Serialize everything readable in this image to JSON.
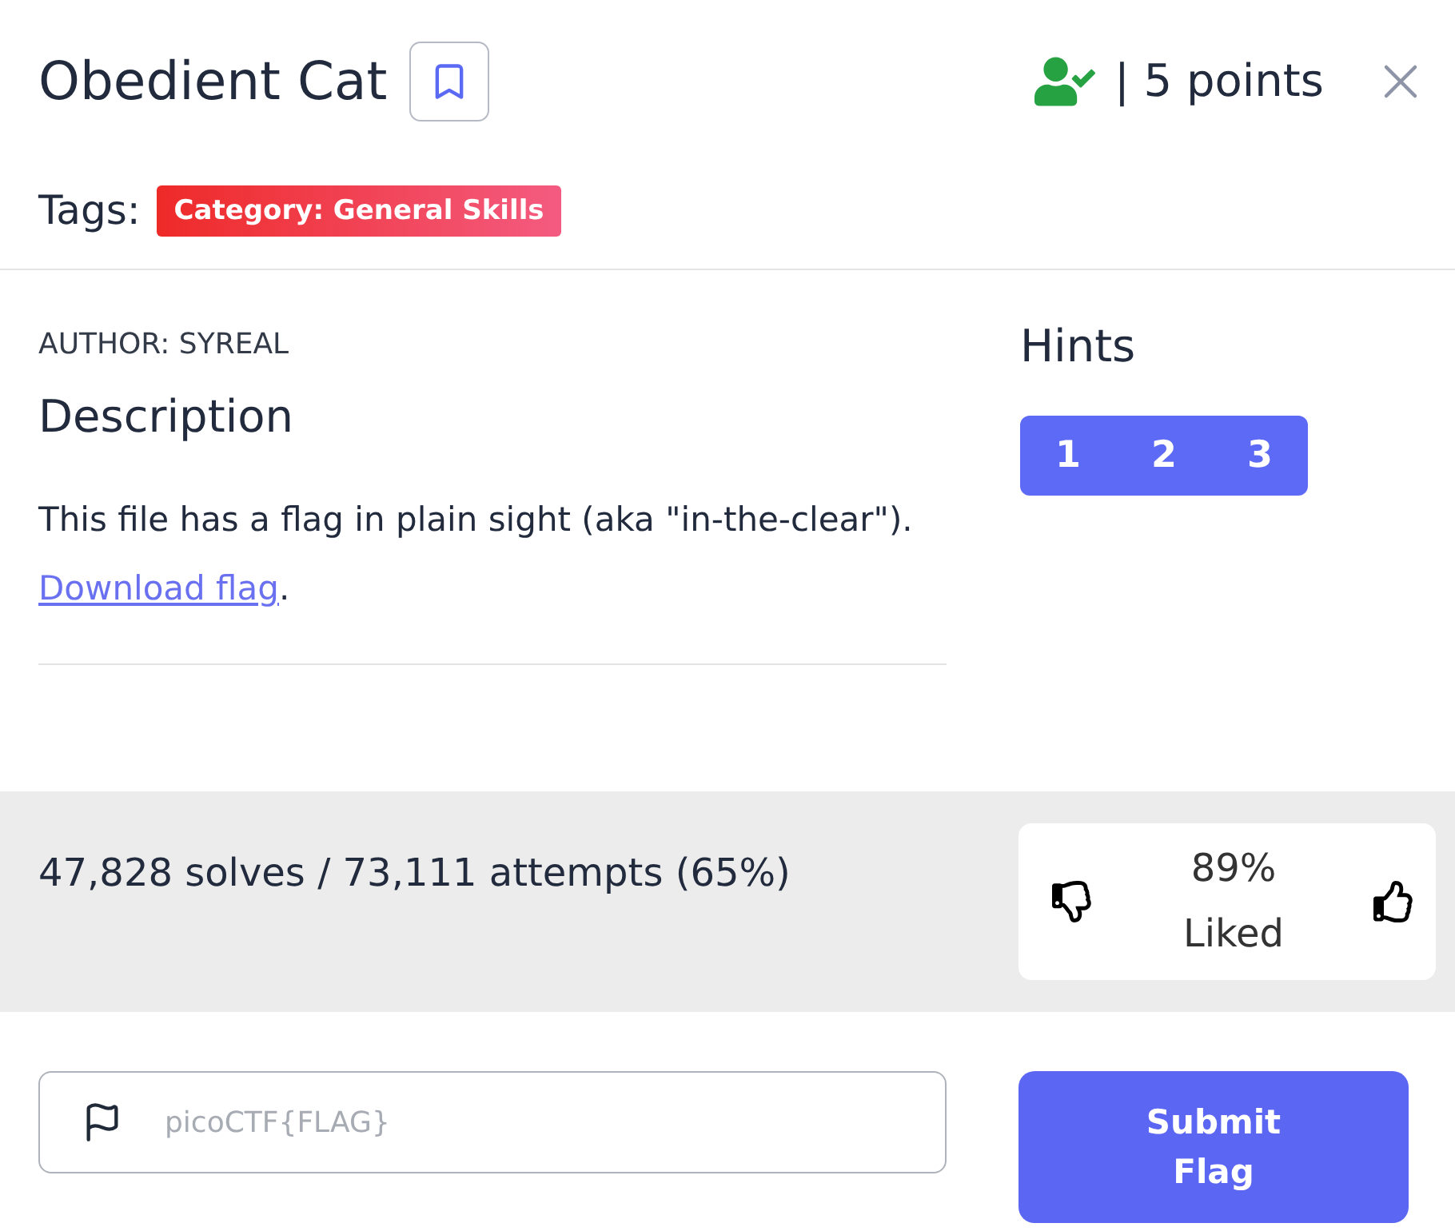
{
  "header": {
    "title": "Obedient Cat",
    "bookmarked": false,
    "solved": true,
    "points": "| 5 points"
  },
  "tags": {
    "label": "Tags:",
    "items": [
      {
        "text": "Category: General Skills"
      }
    ]
  },
  "description": {
    "author": "AUTHOR: SYREAL",
    "heading": "Description",
    "text": "This file has a flag in plain sight (aka \"in-the-clear\").",
    "link": "Download flag",
    "after_link": "."
  },
  "hints": {
    "title": "Hints",
    "buttons": [
      "1",
      "2",
      "3"
    ]
  },
  "stats": {
    "text": "47,828 solves / 73,111 attempts (65%)",
    "rating": {
      "percent": "89%",
      "label": "Liked"
    }
  },
  "flag_form": {
    "placeholder": "picoCTF{FLAG}",
    "submit": "Submit Flag"
  }
}
